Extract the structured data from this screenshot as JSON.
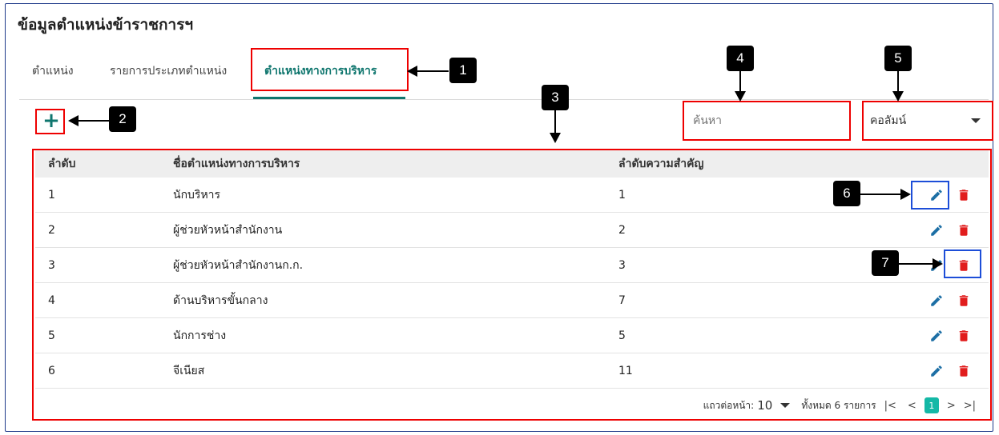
{
  "page": {
    "title": "ข้อมูลตำแหน่งข้าราชการฯ"
  },
  "tabs": [
    {
      "label": "ตำแหน่ง"
    },
    {
      "label": "รายการประเภทตำแหน่ง"
    },
    {
      "label": "ตำแหน่งทางการบริหาร",
      "active": true
    }
  ],
  "toolbar": {
    "add_label": "+",
    "search_placeholder": "ค้นหา",
    "column_select": "คอลัมน์"
  },
  "table": {
    "headers": [
      "ลำดับ",
      "ชื่อตำแหน่งทางการบริหาร",
      "ลำดับความสำคัญ",
      ""
    ],
    "rows": [
      {
        "no": "1",
        "name": "นักบริหาร",
        "priority": "1"
      },
      {
        "no": "2",
        "name": "ผู้ช่วยหัวหน้าสำนักงาน",
        "priority": "2"
      },
      {
        "no": "3",
        "name": "ผู้ช่วยหัวหน้าสำนักงานก.ก.",
        "priority": "3"
      },
      {
        "no": "4",
        "name": "ด้านบริหารขั้นกลาง",
        "priority": "7"
      },
      {
        "no": "5",
        "name": "นักการช่าง",
        "priority": "5"
      },
      {
        "no": "6",
        "name": "จีเนียส",
        "priority": "11"
      }
    ]
  },
  "pagination": {
    "rows_per_page_label": "แถวต่อหน้า:",
    "rows_per_page": "10",
    "total_label": "ทั้งหมด 6 รายการ",
    "first": "|<",
    "prev": "<",
    "current": "1",
    "next": ">",
    "last": ">|"
  },
  "callouts": [
    "1",
    "2",
    "3",
    "4",
    "5",
    "6",
    "7"
  ],
  "colors": {
    "accent": "#0f766e",
    "edit": "#1d6fa5",
    "delete": "#e11d1d",
    "annotation_red": "#ee0000",
    "annotation_blue": "#1d4ed8"
  },
  "icons": {
    "add": "plus-icon",
    "edit": "pencil-icon",
    "delete": "trash-icon",
    "dropdown": "caret-down-icon"
  }
}
